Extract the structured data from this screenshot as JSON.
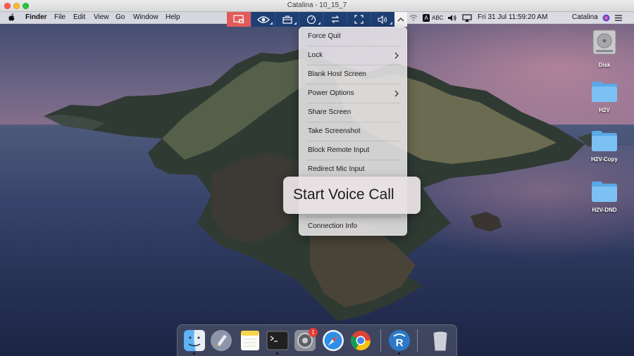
{
  "window": {
    "title": "Catalina - 10_15_7"
  },
  "menubar": {
    "app_name": "Finder",
    "items": [
      "File",
      "Edit",
      "View",
      "Go",
      "Window",
      "Help"
    ],
    "input_source": "ABC",
    "datetime": "Fri 31 Jul  11:59:20 AM",
    "user": "Catalina"
  },
  "remote_toolbar": {
    "buttons": [
      "disconnect-icon",
      "eye-icon",
      "briefcase-icon",
      "gauge-icon",
      "transfer-arrows-icon",
      "fullscreen-icon",
      "speaker-icon",
      "chevron-up-icon"
    ]
  },
  "dropdown": {
    "items": [
      {
        "label": "Force Quit",
        "submenu": false
      },
      {
        "label": "Lock",
        "submenu": true
      },
      {
        "label": "Blank Host Screen",
        "submenu": false
      },
      {
        "label": "Power Options",
        "submenu": true
      },
      {
        "label": "Share Screen",
        "submenu": false
      },
      {
        "label": "Take Screenshot",
        "submenu": false
      },
      {
        "label": "Block Remote Input",
        "submenu": false
      },
      {
        "label": "Redirect Mic Input",
        "submenu": false
      },
      {
        "label": "Connection Info",
        "submenu": false
      }
    ],
    "highlighted": "Start Voice Call"
  },
  "desktop_icons": [
    {
      "label": "Disk",
      "icon": "hard-disk-icon"
    },
    {
      "label": "H2V",
      "icon": "folder-icon"
    },
    {
      "label": "H2V-Copy",
      "icon": "folder-icon"
    },
    {
      "label": "H2V-DND",
      "icon": "folder-icon"
    }
  ],
  "dock": {
    "apps": [
      "finder-icon",
      "launchpad-icon",
      "notes-icon",
      "terminal-icon",
      "system-preferences-icon",
      "safari-icon",
      "chrome-icon",
      "remote-desktop-icon",
      "trash-icon"
    ],
    "badge_system_preferences": "1"
  },
  "colors": {
    "accent_blue": "#1e3f73",
    "disconnect_red": "#e25b5b"
  }
}
